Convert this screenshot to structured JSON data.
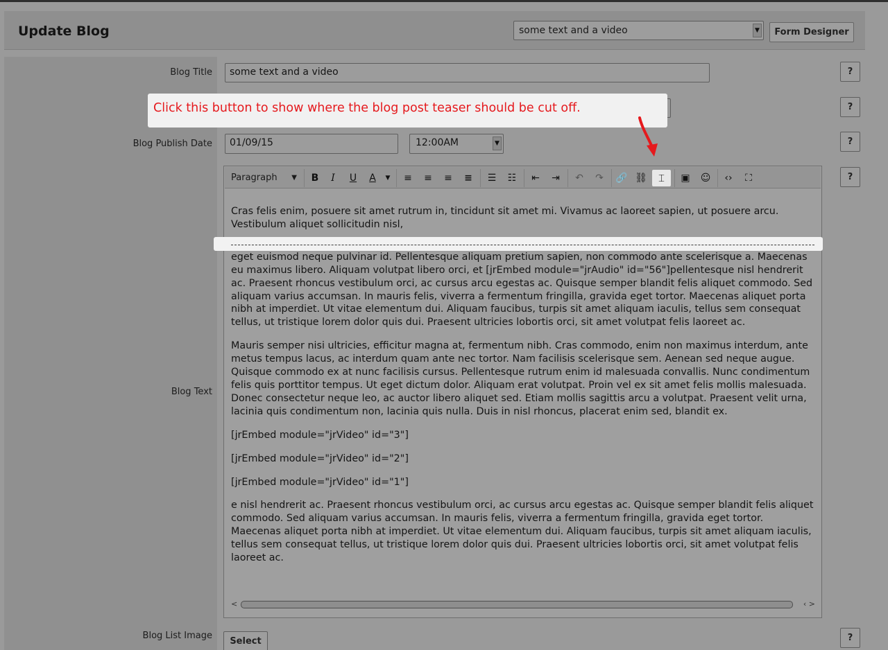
{
  "header": {
    "title": "Update Blog",
    "form_select_value": "some text and a video",
    "form_designer_label": "Form Designer"
  },
  "fields": {
    "title_label": "Blog Title",
    "title_value": "some text and a video",
    "date_label": "Blog Publish Date",
    "date_value": "01/09/15",
    "time_value": "12:00AM",
    "text_label": "Blog Text",
    "image_label": "Blog List Image",
    "select_label": "Select"
  },
  "help": {
    "label": "?"
  },
  "toolbar": {
    "format_value": "Paragraph",
    "bold": "B",
    "italic": "I",
    "underline": "U",
    "text_color": "A"
  },
  "callout": {
    "text": "Click this button to show where the blog post teaser should be cut off.",
    "text_color": "#e5191d"
  },
  "content": {
    "paragraphs": [
      "Cras felis enim, posuere sit amet rutrum in, tincidunt sit amet mi. Vivamus ac laoreet sapien, ut posuere arcu. Vestibulum aliquet sollicitudin nisl,",
      "eget euismod neque pulvinar id. Pellentesque aliquam pretium sapien, non commodo ante scelerisque a. Maecenas eu maximus libero. Aliquam volutpat libero orci, et [jrEmbed module=\"jrAudio\" id=\"56\"]pellentesque nisl hendrerit ac. Praesent rhoncus vestibulum orci, ac cursus arcu egestas ac. Quisque semper blandit felis aliquet commodo. Sed aliquam varius accumsan. In mauris felis, viverra a fermentum fringilla, gravida eget tortor. Maecenas aliquet porta nibh at imperdiet. Ut vitae elementum dui. Aliquam faucibus, turpis sit amet aliquam iaculis, tellus sem consequat tellus, ut tristique lorem dolor quis dui. Praesent ultricies lobortis orci, sit amet volutpat felis laoreet ac.",
      "Mauris semper nisi ultricies, efficitur magna at, fermentum nibh. Cras commodo, enim non maximus interdum, ante metus tempus lacus, ac interdum quam ante nec tortor. Nam facilisis scelerisque sem. Aenean sed neque augue. Quisque commodo ex at nunc facilisis cursus. Pellentesque rutrum enim id malesuada convallis. Nunc condimentum felis quis porttitor tempus. Ut eget dictum dolor. Aliquam erat volutpat. Proin vel ex sit amet felis mollis malesuada. Donec consectetur neque leo, ac auctor libero aliquet sed. Etiam mollis sagittis arcu a volutpat. Praesent velit urna, lacinia quis condimentum non, lacinia quis nulla. Duis in nisl rhoncus, placerat enim sed, blandit ex.",
      "[jrEmbed module=\"jrVideo\" id=\"3\"]",
      "[jrEmbed module=\"jrVideo\" id=\"2\"]",
      "[jrEmbed module=\"jrVideo\" id=\"1\"]",
      "e nisl hendrerit ac. Praesent rhoncus vestibulum orci, ac cursus arcu egestas ac. Quisque semper blandit felis aliquet commodo. Sed aliquam varius accumsan. In mauris felis, viverra a fermentum fringilla, gravida eget tortor. Maecenas aliquet porta nibh at imperdiet. Ut vitae elementum dui. Aliquam faucibus, turpis sit amet aliquam iaculis, tellus sem consequat tellus, ut tristique lorem dolor quis dui. Praesent ultricies lobortis orci, sit amet volutpat felis laoreet ac."
    ]
  }
}
